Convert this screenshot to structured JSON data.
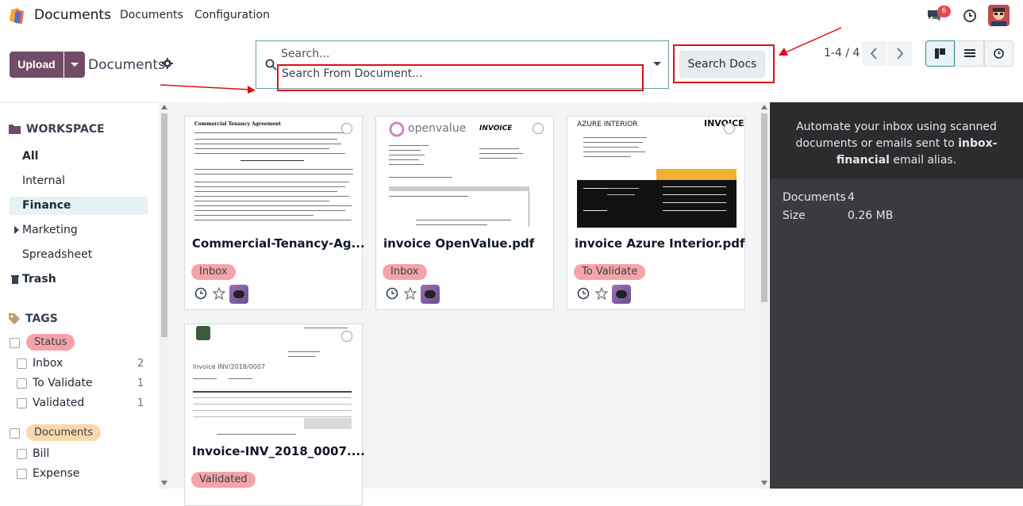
{
  "nav": {
    "app_title": "Documents",
    "menu": [
      "Documents",
      "Configuration"
    ],
    "chat_badge": "6"
  },
  "control": {
    "upload_label": "Upload",
    "breadcrumb": "Documents",
    "search_placeholder": "Search...",
    "search_suggestion": "Search From Document...",
    "search_docs_label": "Search Docs",
    "pager": "1-4 / 4"
  },
  "sidebar": {
    "workspace_title": "WORKSPACE",
    "workspaces": [
      "All",
      "Internal",
      "Finance",
      "Marketing",
      "Spreadsheet",
      "Trash"
    ],
    "tags_title": "TAGS",
    "tag_groups": [
      {
        "name": "Status",
        "color": "#f4a4a8",
        "tags": [
          {
            "label": "Inbox",
            "count": "2"
          },
          {
            "label": "To Validate",
            "count": "1"
          },
          {
            "label": "Validated",
            "count": "1"
          }
        ]
      },
      {
        "name": "Documents",
        "color": "#fad7ad",
        "tags": [
          {
            "label": "Bill",
            "count": ""
          },
          {
            "label": "Expense",
            "count": ""
          }
        ]
      }
    ]
  },
  "cards": [
    {
      "name": "Commercial-Tenancy-Ag...",
      "tag": "Inbox",
      "tag_color": "#f4a4a8",
      "thumb_title": "Commercial Tenancy Agreement"
    },
    {
      "name": "invoice OpenValue.pdf",
      "tag": "Inbox",
      "tag_color": "#f4a4a8",
      "thumb_brand": "openvalue",
      "thumb_title": "INVOICE"
    },
    {
      "name": "invoice Azure Interior.pdf",
      "tag": "To Validate",
      "tag_color": "#f4a4a8",
      "thumb_brand": "AZURE INTERIOR",
      "thumb_title": "INVOICE"
    },
    {
      "name": "Invoice-INV_2018_0007....",
      "tag": "Validated",
      "tag_color": "#f4a4a8",
      "thumb_title": "Invoice INV/2018/0007"
    }
  ],
  "panel": {
    "info_prefix": "Automate your inbox using scanned documents or emails sent to ",
    "info_alias": "inbox-financial",
    "info_suffix": " email alias.",
    "documents_label": "Documents",
    "documents_value": "4",
    "size_label": "Size",
    "size_value": "0.26 MB"
  },
  "colors": {
    "primary": "#714b67",
    "accent": "#3f8e94",
    "annotation": "#d9101a"
  }
}
